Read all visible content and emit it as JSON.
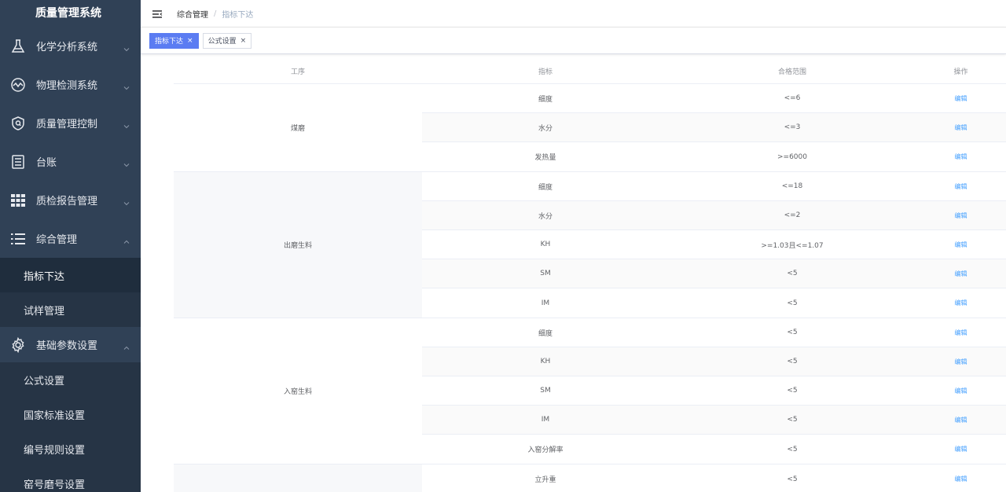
{
  "app": {
    "title": "质量管理系统"
  },
  "sidebar": {
    "menus": [
      {
        "label": "化学分析系统",
        "icon": "flask-icon",
        "expanded": false
      },
      {
        "label": "物理检测系统",
        "icon": "monitor-icon",
        "expanded": false
      },
      {
        "label": "质量管理控制",
        "icon": "shield-icon",
        "expanded": false
      },
      {
        "label": "台账",
        "icon": "ledger-icon",
        "expanded": false
      },
      {
        "label": "质检报告管理",
        "icon": "grid-icon",
        "expanded": false
      },
      {
        "label": "综合管理",
        "icon": "list-icon",
        "expanded": true
      },
      {
        "label": "基础参数设置",
        "icon": "gear-icon",
        "expanded": true
      }
    ],
    "sub_comprehensive": [
      "指标下达",
      "试样管理"
    ],
    "sub_basic": [
      "公式设置",
      "国家标准设置",
      "编号规则设置",
      "窑号磨号设置"
    ]
  },
  "breadcrumb": {
    "items": [
      "综合管理",
      "指标下达"
    ],
    "separator": "/"
  },
  "tags": [
    {
      "label": "指标下达",
      "active": true,
      "close": "×"
    },
    {
      "label": "公式设置",
      "active": false,
      "close": "×"
    }
  ],
  "table": {
    "headers": [
      "工序",
      "指标",
      "合格范围",
      "操作"
    ],
    "edit_label": "编辑",
    "groups": [
      {
        "process": "煤磨",
        "rows": [
          {
            "indicator": "细度",
            "range": "<=6"
          },
          {
            "indicator": "水分",
            "range": "<=3"
          },
          {
            "indicator": "发热量",
            "range": ">=6000"
          }
        ]
      },
      {
        "process": "出磨生料",
        "rows": [
          {
            "indicator": "细度",
            "range": "<=18"
          },
          {
            "indicator": "水分",
            "range": "<=2"
          },
          {
            "indicator": "KH",
            "range": ">=1.03且<=1.07"
          },
          {
            "indicator": "SM",
            "range": "<5"
          },
          {
            "indicator": "IM",
            "range": "<5"
          }
        ]
      },
      {
        "process": "入窑生料",
        "rows": [
          {
            "indicator": "细度",
            "range": "<5"
          },
          {
            "indicator": "KH",
            "range": "<5"
          },
          {
            "indicator": "SM",
            "range": "<5"
          },
          {
            "indicator": "IM",
            "range": "<5"
          },
          {
            "indicator": "入窑分解率",
            "range": "<5"
          }
        ]
      },
      {
        "process": "",
        "rows": [
          {
            "indicator": "立升重",
            "range": "<5"
          }
        ]
      }
    ]
  },
  "colors": {
    "sidebar_bg": "#304156",
    "accent": "#5b7cf2",
    "link": "#409eff"
  }
}
